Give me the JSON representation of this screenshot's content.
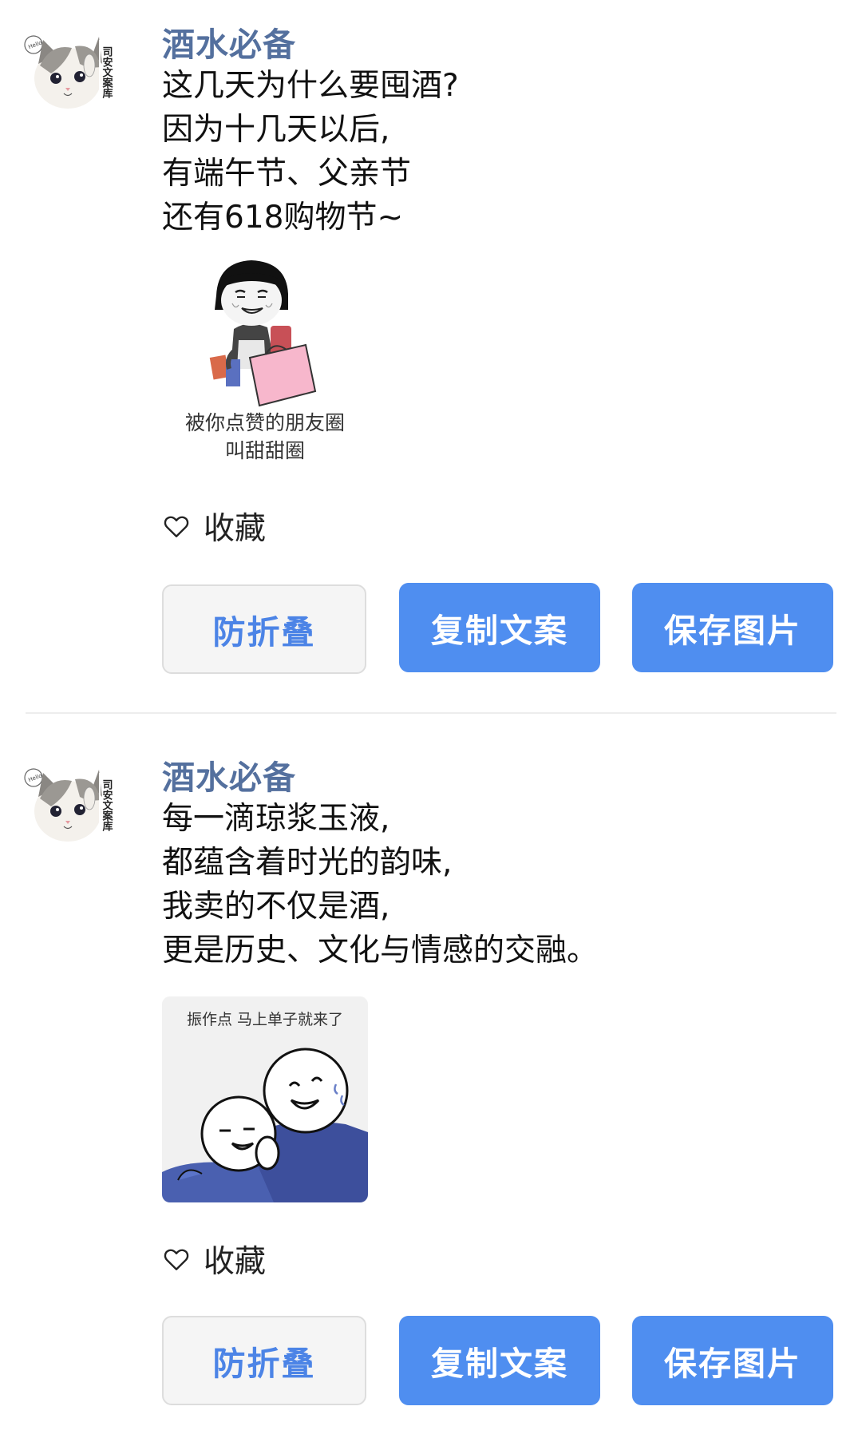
{
  "posts": [
    {
      "avatar": {
        "name": "avatar-cat",
        "vertical_text": "司安文案库"
      },
      "author": "酒水必备",
      "content_lines": [
        "这几天为什么要囤酒?",
        "因为十几天以后,",
        "有端午节、父亲节",
        "还有618购物节~"
      ],
      "image": {
        "icon": "shopping-meme-icon",
        "caption_lines": [
          "被你点赞的朋友圈",
          "叫甜甜圈"
        ]
      },
      "favorite_label": "收藏",
      "buttons": {
        "fold": "防折叠",
        "copy": "复制文案",
        "save": "保存图片"
      }
    },
    {
      "avatar": {
        "name": "avatar-cat",
        "vertical_text": "司安文案库"
      },
      "author": "酒水必备",
      "content_lines": [
        "每一滴琼浆玉液,",
        "都蕴含着时光的韵味,",
        "我卖的不仅是酒,",
        "更是历史、文化与情感的交融。"
      ],
      "image": {
        "icon": "hug-meme-icon",
        "caption_lines": [
          "振作点 马上单子就来了"
        ]
      },
      "favorite_label": "收藏",
      "buttons": {
        "fold": "防折叠",
        "copy": "复制文案",
        "save": "保存图片"
      }
    }
  ],
  "colors": {
    "author": "#54709e",
    "primary_button": "#4f8ef0",
    "fold_text": "#4c84e6"
  }
}
